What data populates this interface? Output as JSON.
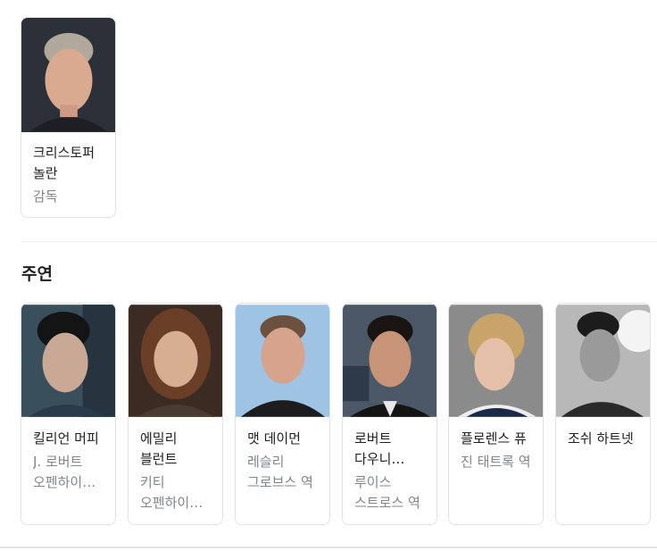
{
  "director": {
    "name": "크리스토퍼 놀란",
    "role": "감독",
    "photo_icon": "person-photo"
  },
  "cast_section": {
    "title": "주연",
    "members": [
      {
        "name": "킬리언 머피",
        "role": "J. 로버트 오펜하이…",
        "photo_icon": "person-photo"
      },
      {
        "name": "에밀리 블런트",
        "role": "키티 오펜하이머 역",
        "photo_icon": "person-photo"
      },
      {
        "name": "맷 데이먼",
        "role": "레슬리 그로브스 역",
        "photo_icon": "person-photo"
      },
      {
        "name": "로버트 다우니 주니…",
        "role": "루이스 스트로스 역",
        "photo_icon": "person-photo"
      },
      {
        "name": "플로렌스 퓨",
        "role": "진 태트록 역",
        "photo_icon": "person-photo"
      },
      {
        "name": "조쉬 하트넷",
        "role": "",
        "photo_icon": "person-photo"
      }
    ]
  }
}
